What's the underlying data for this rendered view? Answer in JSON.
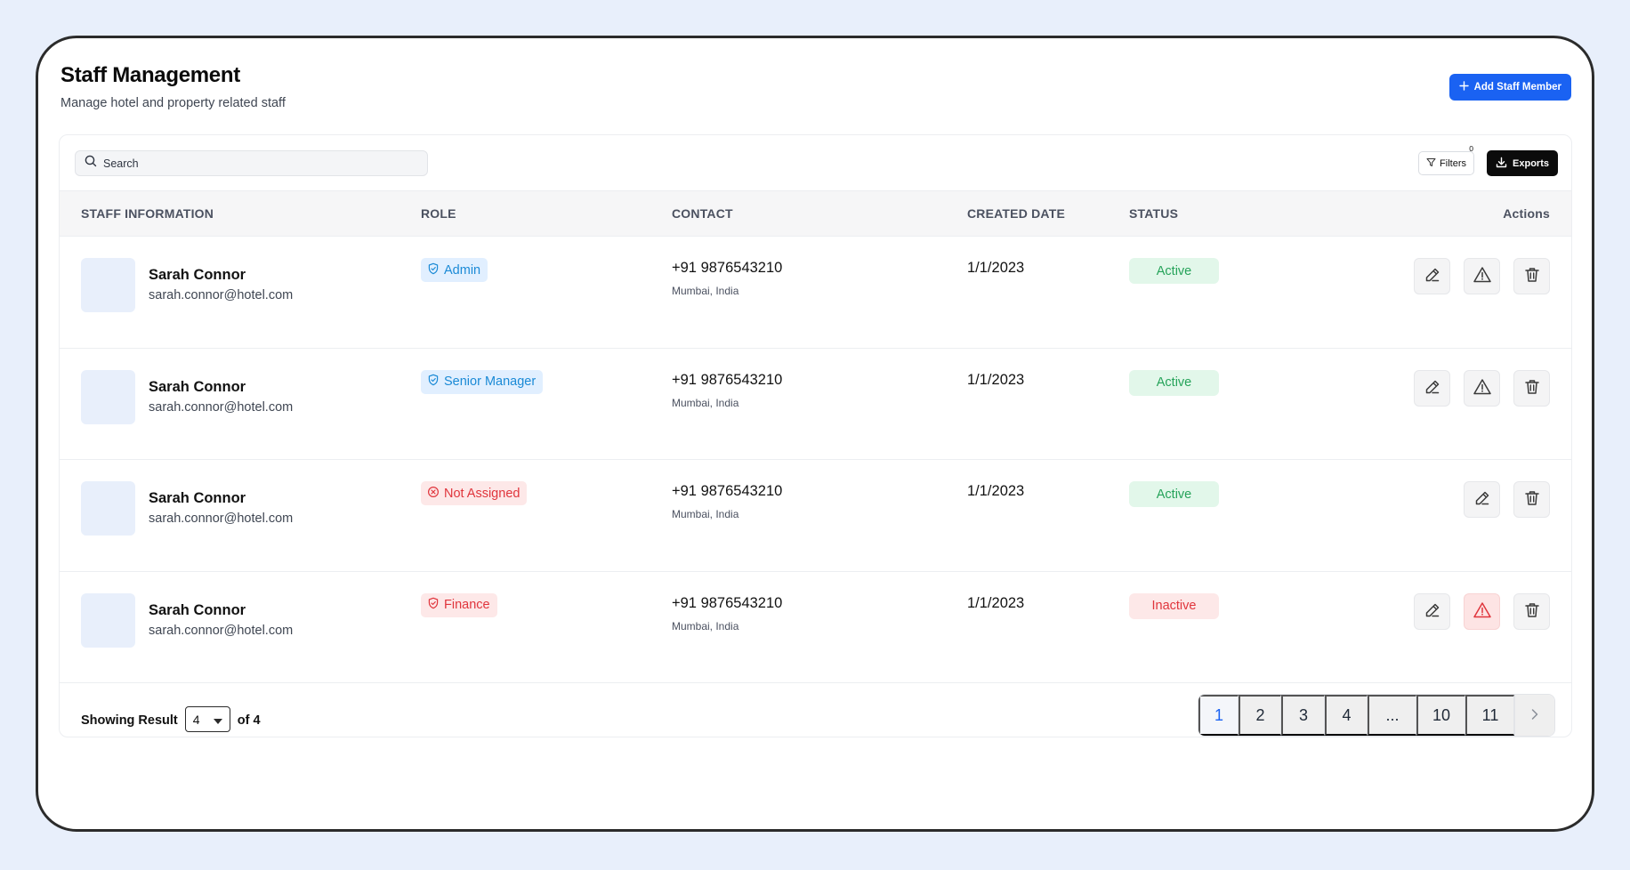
{
  "header": {
    "title": "Staff Management",
    "subtitle": "Manage hotel and property related staff",
    "add_button": "Add Staff Member"
  },
  "toolbar": {
    "search_placeholder": "Search",
    "filters_label": "Filters",
    "filters_count": "0",
    "exports_label": "Exports"
  },
  "table": {
    "columns": [
      "STAFF INFORMATION",
      "ROLE",
      "CONTACT",
      "CREATED DATE",
      "STATUS",
      "Actions"
    ],
    "rows": [
      {
        "name": "Sarah Connor",
        "email": "sarah.connor@hotel.com",
        "role": "Admin",
        "role_color": "blue",
        "role_icon": "shield-check-icon",
        "phone": "+91 9876543210",
        "location": "Mumbai, India",
        "created": "1/1/2023",
        "status": "Active"
      },
      {
        "name": "Sarah Connor",
        "email": "sarah.connor@hotel.com",
        "role": "Senior Manager",
        "role_color": "blue",
        "role_icon": "shield-check-icon",
        "phone": "+91 9876543210",
        "location": "Mumbai, India",
        "created": "1/1/2023",
        "status": "Active"
      },
      {
        "name": "Sarah Connor",
        "email": "sarah.connor@hotel.com",
        "role": "Not Assigned",
        "role_color": "red",
        "role_icon": "circle-x-icon",
        "phone": "+91 9876543210",
        "location": "Mumbai, India",
        "created": "1/1/2023",
        "status": "Active"
      },
      {
        "name": "Sarah Connor",
        "email": "sarah.connor@hotel.com",
        "role": "Finance",
        "role_color": "red",
        "role_icon": "shield-check-icon",
        "phone": "+91 9876543210",
        "location": "Mumbai, India",
        "created": "1/1/2023",
        "status": "Inactive"
      }
    ]
  },
  "footer": {
    "showing_label": "Showing Result",
    "page_size": "4",
    "of_label": "of 4",
    "pages": [
      "1",
      "2",
      "3",
      "4",
      "...",
      "10",
      "11"
    ],
    "current_page": "1"
  },
  "colors": {
    "background": "#e8effb",
    "primary": "#1a62f2",
    "active_text": "#26a35a",
    "active_bg": "#e2f7ea",
    "danger": "#e0353c",
    "danger_bg": "#fde8e8",
    "role_blue": "#1b8ad6",
    "role_blue_bg": "#e1efff"
  }
}
